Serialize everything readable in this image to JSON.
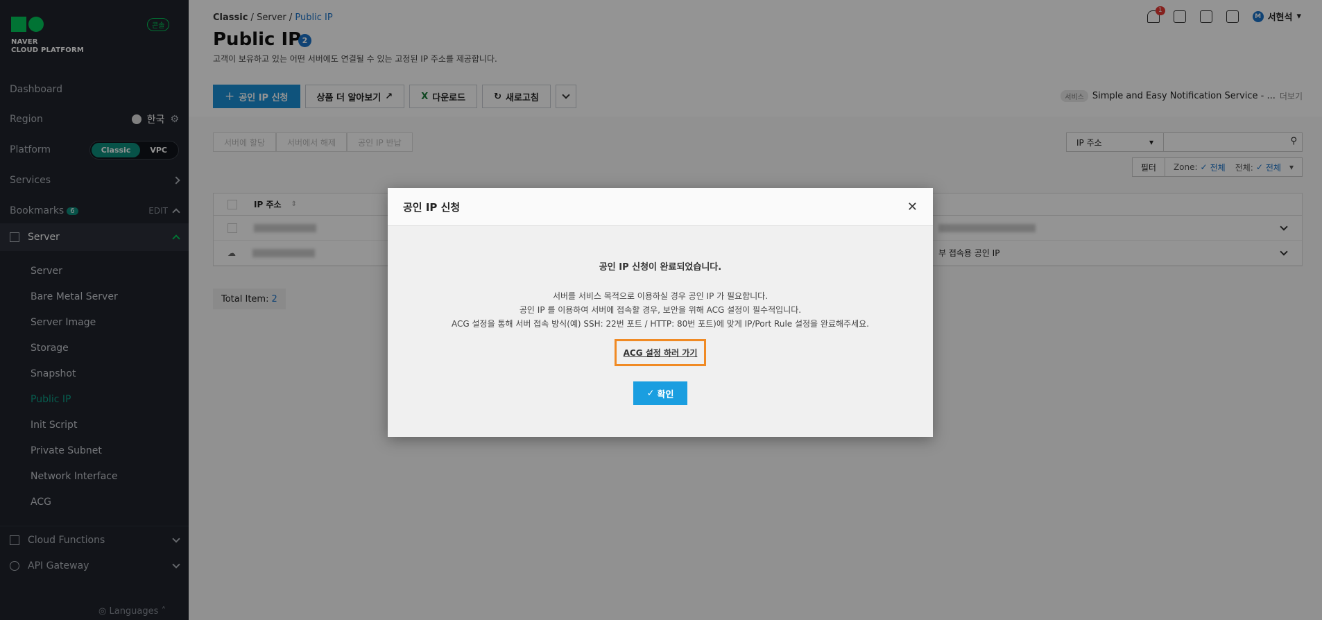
{
  "sidebar": {
    "logo_line1": "NAVER",
    "logo_line2": "CLOUD PLATFORM",
    "console_badge": "콘솔",
    "dashboard": "Dashboard",
    "region_label": "Region",
    "region_value": "한국",
    "platform_label": "Platform",
    "platform_options": [
      "Classic",
      "VPC"
    ],
    "services_label": "Services",
    "bookmarks_label": "Bookmarks",
    "bookmarks_count": "6",
    "bookmarks_edit": "EDIT",
    "server_group": "Server",
    "server_items": [
      "Server",
      "Bare Metal Server",
      "Server Image",
      "Storage",
      "Snapshot",
      "Public IP",
      "Init Script",
      "Private Subnet",
      "Network Interface",
      "ACG"
    ],
    "active_item": "Public IP",
    "cloud_functions": "Cloud Functions",
    "api_gateway": "API Gateway",
    "languages": "Languages"
  },
  "header": {
    "breadcrumb": [
      "Classic",
      "Server",
      "Public IP"
    ],
    "title": "Public IP",
    "title_count": "2",
    "description": "고객이 보유하고 있는 어떤 서버에도 연결될 수 있는 고정된 IP 주소를 제공합니다.",
    "notification_count": "1",
    "user_initial": "M",
    "user_name": "서현석"
  },
  "toolbar": {
    "request_ip": "공인 IP 신청",
    "learn_more": "상품 더 알아보기",
    "download": "다운로드",
    "refresh": "새로고침",
    "service_tag": "서비스",
    "service_name": "Simple and Easy Notification Service - ...",
    "more": "더보기"
  },
  "actions": [
    "서버에 할당",
    "서버에서 해제",
    "공인 IP 반납"
  ],
  "search": {
    "select_value": "IP 주소"
  },
  "filter": {
    "label": "필터",
    "zone_label": "Zone:",
    "zone_value": "전체",
    "all_label": "전체:",
    "all_value": "전체"
  },
  "table": {
    "header": "IP 주소",
    "row2_desc": "부 접속용 공인 IP"
  },
  "total": {
    "label": "Total Item:",
    "count": "2"
  },
  "modal": {
    "title": "공인 IP 신청",
    "heading": "공인 IP 신청이 완료되었습니다.",
    "desc_lines": [
      "서버를 서비스 목적으로 이용하실 경우 공인 IP 가 필요합니다.",
      "공인 IP 를 이용하여 서버에 접속할 경우, 보안을 위해 ACG 설정이 필수적입니다.",
      "ACG 설정을 통해 서버 접속 방식(예) SSH: 22번 포트 / HTTP: 80번 포트)에 맞게 IP/Port Rule 설정을 완료해주세요."
    ],
    "acg_link": "ACG 설정 하러 가기",
    "confirm": "확인"
  }
}
